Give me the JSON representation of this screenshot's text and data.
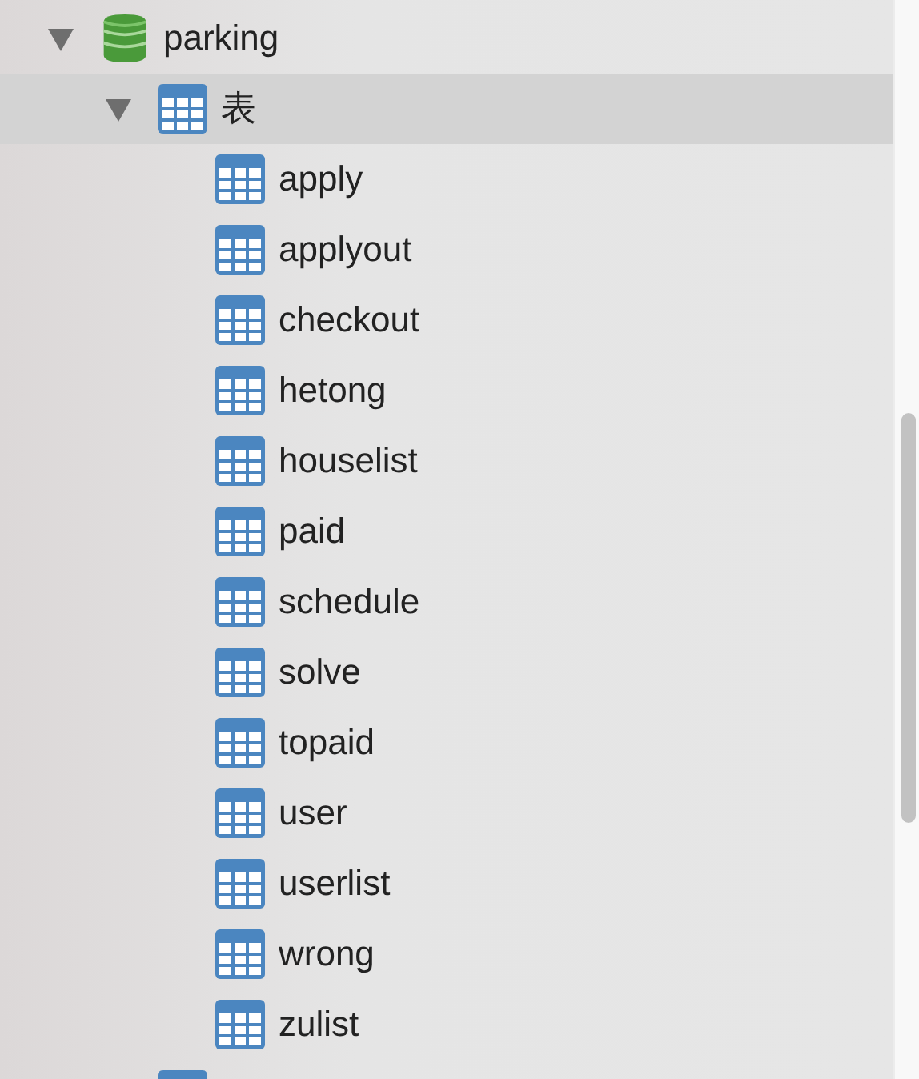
{
  "tree": [
    {
      "label": "parking",
      "kind": "database",
      "expanded": true,
      "selected": false,
      "children": [
        {
          "label": "表",
          "kind": "table-group",
          "expanded": true,
          "selected": true,
          "children": [
            {
              "label": "apply",
              "kind": "table",
              "selected": false
            },
            {
              "label": "applyout",
              "kind": "table",
              "selected": false
            },
            {
              "label": "checkout",
              "kind": "table",
              "selected": false
            },
            {
              "label": "hetong",
              "kind": "table",
              "selected": false
            },
            {
              "label": "houselist",
              "kind": "table",
              "selected": false
            },
            {
              "label": "paid",
              "kind": "table",
              "selected": false
            },
            {
              "label": "schedule",
              "kind": "table",
              "selected": false
            },
            {
              "label": "solve",
              "kind": "table",
              "selected": false
            },
            {
              "label": "topaid",
              "kind": "table",
              "selected": false
            },
            {
              "label": "user",
              "kind": "table",
              "selected": false
            },
            {
              "label": "userlist",
              "kind": "table",
              "selected": false
            },
            {
              "label": "wrong",
              "kind": "table",
              "selected": false
            },
            {
              "label": "zulist",
              "kind": "table",
              "selected": false
            }
          ]
        },
        {
          "kind": "table-group",
          "selected": false
        }
      ]
    }
  ]
}
